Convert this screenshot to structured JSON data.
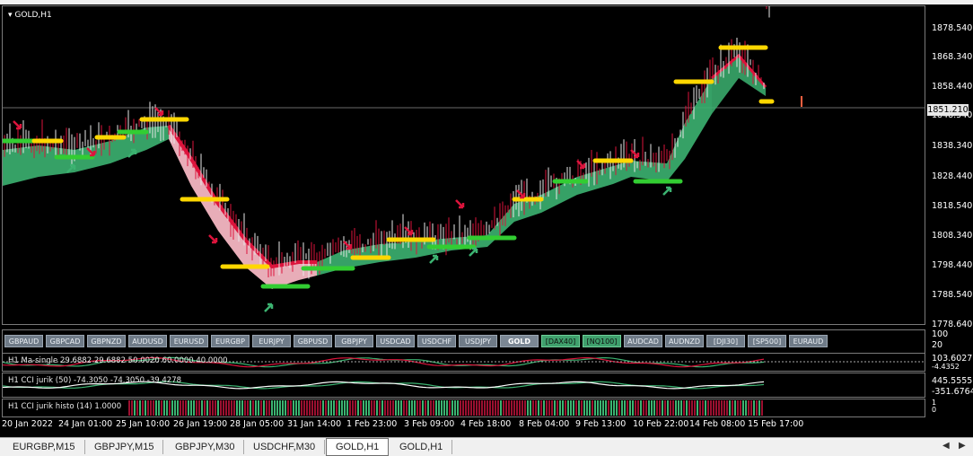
{
  "chart": {
    "title": "GOLD,H1",
    "current_price": "1851.210",
    "price_axis": [
      "1878.540",
      "1868.340",
      "1858.440",
      "1848.540",
      "1838.340",
      "1828.440",
      "1818.540",
      "1808.340",
      "1798.440",
      "1788.540",
      "1778.640"
    ],
    "time_axis": [
      "20 Jan 2022",
      "24 Jan 01:00",
      "25 Jan 10:00",
      "26 Jan 19:00",
      "28 Jan 05:00",
      "31 Jan 14:00",
      "1 Feb 23:00",
      "3 Feb 09:00",
      "4 Feb 18:00",
      "8 Feb 04:00",
      "9 Feb 13:00",
      "10 Feb 22:00",
      "14 Feb 08:00",
      "15 Feb 17:00"
    ]
  },
  "symbol_buttons": [
    {
      "label": "GBPAUD",
      "state": "normal"
    },
    {
      "label": "GBPCAD",
      "state": "normal"
    },
    {
      "label": "GBPNZD",
      "state": "normal"
    },
    {
      "label": "AUDUSD",
      "state": "normal"
    },
    {
      "label": "EURUSD",
      "state": "normal"
    },
    {
      "label": "EURGBP",
      "state": "normal"
    },
    {
      "label": "EURJPY",
      "state": "normal"
    },
    {
      "label": "GBPUSD",
      "state": "normal"
    },
    {
      "label": "GBPJPY",
      "state": "normal"
    },
    {
      "label": "USDCAD",
      "state": "normal"
    },
    {
      "label": "USDCHF",
      "state": "normal"
    },
    {
      "label": "USDJPY",
      "state": "normal"
    },
    {
      "label": "GOLD",
      "state": "active"
    },
    {
      "label": "[DAX40]",
      "state": "green"
    },
    {
      "label": "[NQ100]",
      "state": "green"
    },
    {
      "label": "AUDCAD",
      "state": "normal"
    },
    {
      "label": "AUDNZD",
      "state": "normal"
    },
    {
      "label": "[DJI30]",
      "state": "normal"
    },
    {
      "label": "[SP500]",
      "state": "normal"
    },
    {
      "label": "EURAUD",
      "state": "normal"
    }
  ],
  "indicators": {
    "ma_signals": {
      "label": "H1  Ma-single  29.6882  29.6882  50.0020  60.0000  40.0000",
      "scale_top": "100",
      "scale_mid": "20",
      "value1": "103.6027",
      "value2": "-4.4352"
    },
    "cci_jurik": {
      "label": "H1  CCI  jurik (50)  -74.3050  -74.3050  -39.4278",
      "value1": "445.5555",
      "value2": "-351.6764"
    },
    "cci_histo": {
      "label": "H1  CCI  jurik histo  (14)  1.0000",
      "value1": "1",
      "value2": "0"
    }
  },
  "bottom_tabs": [
    {
      "label": "EURGBP,M15",
      "active": false
    },
    {
      "label": "GBPJPY,M15",
      "active": false
    },
    {
      "label": "GBPJPY,M30",
      "active": false
    },
    {
      "label": "USDCHF,M30",
      "active": false
    },
    {
      "label": "GOLD,H1",
      "active": true
    },
    {
      "label": "GOLD,H1",
      "active": false
    }
  ],
  "colors": {
    "bull": "#3cb371",
    "bear": "#dc143c",
    "band_green": "#3cb371",
    "band_pink": "#f4b6c2",
    "signal_yellow": "#ffd700",
    "signal_green": "#32cd32"
  }
}
